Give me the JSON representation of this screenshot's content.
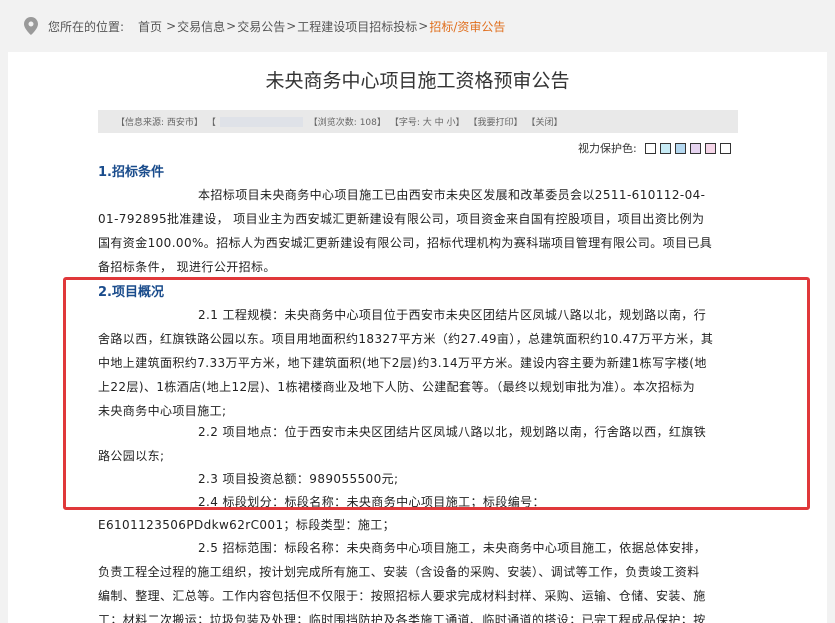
{
  "breadcrumb": {
    "prefix": "您所在的位置:",
    "items": [
      "首页",
      "交易信息",
      "交易公告",
      "工程建设项目招标投标",
      "招标/资审公告"
    ],
    "separator": ">"
  },
  "article": {
    "title": "未央商务中心项目施工资格预审公告",
    "info_bar": {
      "source": "【信息来源: 西安市】",
      "blurred_open": "【",
      "views": "【浏览次数: 108】",
      "font_size": "【字号: 大 中 小】",
      "print": "【我要打印】",
      "close": "【关闭】"
    },
    "protect_label": "视力保护色:",
    "protect_colors": [
      "#ffffff",
      "#c7ebf5",
      "#b5d8f0",
      "#e6d4f0",
      "#f5d5e8",
      "#ffffff"
    ],
    "section1_title": "1.招标条件",
    "section1_lines": [
      "本招标项目未央商务中心项目施工已由西安市未央区发展和改革委员会以2511-610112-04-",
      "01-792895批准建设， 项目业主为西安城汇更新建设有限公司，项目资金来自国有控股项目，项目出资比例为",
      "国有资金100.00%。招标人为西安城汇更新建设有限公司，招标代理机构为赛科瑞项目管理有限公司。项目已具",
      "备招标条件， 现进行公开招标。"
    ],
    "section2_title": "2.项目概况",
    "section2_lines": [
      "2.1 工程规模：未央商务中心项目位于西安市未央区团结片区凤城八路以北，规划路以南，行",
      "舍路以西，红旗铁路公园以东。项目用地面积约18327平方米（约27.49亩），总建筑面积约10.47万平方米，其",
      "中地上建筑面积约7.33万平方米，地下建筑面积(地下2层)约3.14万平方米。建设内容主要为新建1栋写字楼(地",
      "上22层)、1栋酒店(地上12层)、1栋裙楼商业及地下人防、公建配套等。（最终以规划审批为准）。本次招标为",
      "未央商务中心项目施工;",
      "2.2 项目地点：位于西安市未央区团结片区凤城八路以北，规划路以南，行舍路以西，红旗铁",
      "路公园以东;",
      "2.3 项目投资总额：989055500元;",
      "2.4 标段划分：标段名称：未央商务中心项目施工；标段编号：",
      "E6101123506PDdkw62rC001；标段类型：施工；",
      "2.5 招标范围：标段名称：未央商务中心项目施工，未央商务中心项目施工，依据总体安排，",
      "负责工程全过程的施工组织，按计划完成所有施工、安装（含设备的采购、安装）、调试等工作，负责竣工资料",
      "编制、整理、汇总等。工作内容包括但不仅限于：按照招标人要求完成材料封样、采购、运输、仓储、安装、施",
      "工；材料二次搬运；垃圾包装及处理；临时围挡防护及各类施工通道、临时通道的搭设；已完工程成品保护；按"
    ]
  },
  "colors": {
    "highlight_border": "#e0383a",
    "section_title": "#1a4c8c",
    "breadcrumb_active": "#e07020"
  }
}
